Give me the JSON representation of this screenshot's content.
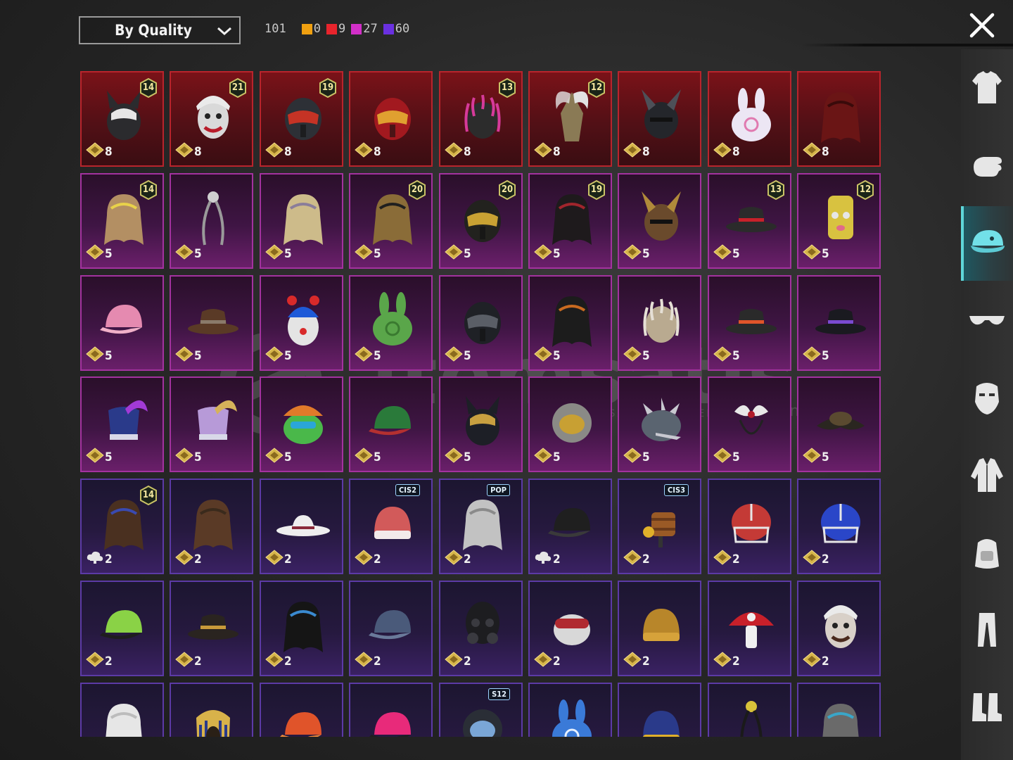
{
  "toolbar": {
    "sort_label": "By Quality",
    "total": "101",
    "counts": [
      {
        "color": "#f0a010",
        "value": "0"
      },
      {
        "color": "#e8242c",
        "value": "9"
      },
      {
        "color": "#d22fc8",
        "value": "27"
      },
      {
        "color": "#6a30e0",
        "value": "60"
      }
    ]
  },
  "watermark": {
    "text": "itemsatis",
    "sub": "HESAP / İTEM / EPİN",
    "com": ".com"
  },
  "sidebar": {
    "items": [
      {
        "name": "outfit",
        "icon": "outfit-icon",
        "active": false
      },
      {
        "name": "emote",
        "icon": "hand-icon",
        "active": false
      },
      {
        "name": "headwear",
        "icon": "cap-icon",
        "active": true
      },
      {
        "name": "eyewear",
        "icon": "glasses-icon",
        "active": false
      },
      {
        "name": "face",
        "icon": "mask-icon",
        "active": false
      },
      {
        "name": "top",
        "icon": "jacket-icon",
        "active": false
      },
      {
        "name": "backpack",
        "icon": "backpack-icon",
        "active": false
      },
      {
        "name": "pants",
        "icon": "pants-icon",
        "active": false
      },
      {
        "name": "shoes",
        "icon": "boots-icon",
        "active": false
      }
    ]
  },
  "items": [
    {
      "q": "red",
      "pts": "8",
      "lvl": "14",
      "shape": "cat-helmet",
      "c1": "#2b2b2e",
      "c2": "#e6e6e6"
    },
    {
      "q": "red",
      "pts": "8",
      "lvl": "21",
      "shape": "joker",
      "c1": "#d9d9d9",
      "c2": "#b81c2a"
    },
    {
      "q": "red",
      "pts": "8",
      "lvl": "19",
      "shape": "visor-helmet",
      "c1": "#2d3036",
      "c2": "#c53325"
    },
    {
      "q": "red",
      "pts": "8",
      "lvl": "",
      "shape": "visor-helmet",
      "c1": "#a2191f",
      "c2": "#e0a030"
    },
    {
      "q": "red",
      "pts": "8",
      "lvl": "13",
      "shape": "dread-mask",
      "c1": "#d63a9a",
      "c2": "#2c2c2c"
    },
    {
      "q": "red",
      "pts": "8",
      "lvl": "12",
      "shape": "winged-helm",
      "c1": "#8a7a55",
      "c2": "#e2e2e2"
    },
    {
      "q": "red",
      "pts": "8",
      "lvl": "",
      "shape": "horn-helm",
      "c1": "#24262b",
      "c2": "#4d5058"
    },
    {
      "q": "red",
      "pts": "8",
      "lvl": "",
      "shape": "bunny",
      "c1": "#ece6f4",
      "c2": "#e07ab0"
    },
    {
      "q": "red",
      "pts": "8",
      "lvl": "",
      "shape": "hair",
      "c1": "#6a1515",
      "c2": "#3a0a0a"
    },
    {
      "q": "pink",
      "pts": "5",
      "lvl": "14",
      "shape": "hair",
      "c1": "#b38f63",
      "c2": "#e8d24a"
    },
    {
      "q": "pink",
      "pts": "5",
      "lvl": "",
      "shape": "antenna",
      "c1": "#9a9a9a",
      "c2": "#d0d0d0"
    },
    {
      "q": "pink",
      "pts": "5",
      "lvl": "",
      "shape": "hair",
      "c1": "#cdbb8a",
      "c2": "#8a7d9a"
    },
    {
      "q": "pink",
      "pts": "5",
      "lvl": "20",
      "shape": "hair",
      "c1": "#8a6c38",
      "c2": "#1f1f1f"
    },
    {
      "q": "pink",
      "pts": "5",
      "lvl": "20",
      "shape": "visor-helmet",
      "c1": "#22221e",
      "c2": "#c9a233"
    },
    {
      "q": "pink",
      "pts": "5",
      "lvl": "19",
      "shape": "hair",
      "c1": "#1e1a1c",
      "c2": "#a0252c"
    },
    {
      "q": "pink",
      "pts": "5",
      "lvl": "",
      "shape": "horn-helm",
      "c1": "#6a4a2c",
      "c2": "#b08a3a"
    },
    {
      "q": "pink",
      "pts": "5",
      "lvl": "13",
      "shape": "hat",
      "c1": "#2b2b2b",
      "c2": "#c8202a"
    },
    {
      "q": "pink",
      "pts": "5",
      "lvl": "12",
      "shape": "can",
      "c1": "#d8c240",
      "c2": "#e6e6e6"
    },
    {
      "q": "pink",
      "pts": "5",
      "lvl": "",
      "shape": "cap",
      "c1": "#e58ab0",
      "c2": "#f0b0c8"
    },
    {
      "q": "pink",
      "pts": "5",
      "lvl": "",
      "shape": "hat",
      "c1": "#5a3a26",
      "c2": "#8a7a6a"
    },
    {
      "q": "pink",
      "pts": "5",
      "lvl": "",
      "shape": "clown",
      "c1": "#e4e4e4",
      "c2": "#1e5ad8"
    },
    {
      "q": "pink",
      "pts": "5",
      "lvl": "",
      "shape": "bunny",
      "c1": "#5aa64a",
      "c2": "#3a7a30"
    },
    {
      "q": "pink",
      "pts": "5",
      "lvl": "",
      "shape": "visor-helmet",
      "c1": "#1f2126",
      "c2": "#5a5e66"
    },
    {
      "q": "pink",
      "pts": "5",
      "lvl": "",
      "shape": "hair",
      "c1": "#1c1c1c",
      "c2": "#c86a20"
    },
    {
      "q": "pink",
      "pts": "5",
      "lvl": "",
      "shape": "dread-mask",
      "c1": "#e6e0d6",
      "c2": "#b9aa90"
    },
    {
      "q": "pink",
      "pts": "5",
      "lvl": "",
      "shape": "hat",
      "c1": "#2a2a2a",
      "c2": "#e0542a"
    },
    {
      "q": "pink",
      "pts": "5",
      "lvl": "",
      "shape": "hat",
      "c1": "#1a1a20",
      "c2": "#7a4ad0"
    },
    {
      "q": "pink",
      "pts": "5",
      "lvl": "",
      "shape": "shako",
      "c1": "#2a3a8a",
      "c2": "#a23ad6"
    },
    {
      "q": "pink",
      "pts": "5",
      "lvl": "",
      "shape": "shako",
      "c1": "#b79ad8",
      "c2": "#d6b25a"
    },
    {
      "q": "pink",
      "pts": "5",
      "lvl": "",
      "shape": "frog",
      "c1": "#4ab84a",
      "c2": "#e07a2a"
    },
    {
      "q": "pink",
      "pts": "5",
      "lvl": "",
      "shape": "cap",
      "c1": "#2a7a3a",
      "c2": "#b43030"
    },
    {
      "q": "pink",
      "pts": "5",
      "lvl": "",
      "shape": "cat-helmet",
      "c1": "#1d1f26",
      "c2": "#c8a040"
    },
    {
      "q": "pink",
      "pts": "5",
      "lvl": "",
      "shape": "astro",
      "c1": "#8a8a86",
      "c2": "#c8a033"
    },
    {
      "q": "pink",
      "pts": "5",
      "lvl": "",
      "shape": "spike-helm",
      "c1": "#5a6470",
      "c2": "#c8c8d0"
    },
    {
      "q": "pink",
      "pts": "5",
      "lvl": "",
      "shape": "bow",
      "c1": "#e8e8e8",
      "c2": "#b01c2a"
    },
    {
      "q": "pink",
      "pts": "5",
      "lvl": "",
      "shape": "tricorn",
      "c1": "#2a2620",
      "c2": "#5a4a30"
    },
    {
      "q": "purple",
      "pts": "2",
      "lvl": "14",
      "shape": "hair",
      "c1": "#4a3020",
      "c2": "#3a4ab0",
      "cloud": true
    },
    {
      "q": "purple",
      "pts": "2",
      "lvl": "",
      "shape": "hair",
      "c1": "#5a3a26",
      "c2": "#3a2a1c"
    },
    {
      "q": "purple",
      "pts": "2",
      "lvl": "",
      "shape": "sunhat",
      "c1": "#eeeeee",
      "c2": "#8a2a3a"
    },
    {
      "q": "purple",
      "pts": "2",
      "lvl": "",
      "tag": "CIS2",
      "shape": "beanie",
      "c1": "#d25a5a",
      "c2": "#f2eaea"
    },
    {
      "q": "purple",
      "pts": "2",
      "lvl": "",
      "tag": "POP",
      "shape": "hair",
      "c1": "#c2c2c2",
      "c2": "#8a8a8a"
    },
    {
      "q": "purple",
      "pts": "2",
      "lvl": "",
      "shape": "cap",
      "c1": "#1f1f1f",
      "c2": "#3a3a3a",
      "cloud": true
    },
    {
      "q": "purple",
      "pts": "2",
      "lvl": "",
      "tag": "CIS3",
      "shape": "barrel",
      "c1": "#9a5a26",
      "c2": "#6a3a1a"
    },
    {
      "q": "purple",
      "pts": "2",
      "lvl": "",
      "shape": "football",
      "c1": "#c43a36",
      "c2": "#e6e6e6"
    },
    {
      "q": "purple",
      "pts": "2",
      "lvl": "",
      "shape": "football",
      "c1": "#2a46c8",
      "c2": "#e6e6e6"
    },
    {
      "q": "purple",
      "pts": "2",
      "lvl": "",
      "shape": "cap",
      "c1": "#8ad246",
      "c2": "#1e1e1e"
    },
    {
      "q": "purple",
      "pts": "2",
      "lvl": "",
      "shape": "hat",
      "c1": "#2a2420",
      "c2": "#c89a3a"
    },
    {
      "q": "purple",
      "pts": "2",
      "lvl": "",
      "shape": "hair",
      "c1": "#151515",
      "c2": "#3a8ad0"
    },
    {
      "q": "purple",
      "pts": "2",
      "lvl": "",
      "shape": "cap",
      "c1": "#4a5a7a",
      "c2": "#6a7a9a"
    },
    {
      "q": "purple",
      "pts": "2",
      "lvl": "",
      "shape": "gasmask",
      "c1": "#1d1d20",
      "c2": "#3a3a40"
    },
    {
      "q": "purple",
      "pts": "2",
      "lvl": "",
      "shape": "goggle",
      "c1": "#d8d8d8",
      "c2": "#b02a30"
    },
    {
      "q": "purple",
      "pts": "2",
      "lvl": "",
      "shape": "beanie",
      "c1": "#b8862a",
      "c2": "#d6a23a"
    },
    {
      "q": "purple",
      "pts": "2",
      "lvl": "",
      "shape": "mushroom",
      "c1": "#c8202a",
      "c2": "#f0f0f0"
    },
    {
      "q": "purple",
      "pts": "2",
      "lvl": "",
      "shape": "joker",
      "c1": "#d8d0c8",
      "c2": "#4a2a1e"
    },
    {
      "q": "purple",
      "pts": "",
      "lvl": "",
      "shape": "hair",
      "c1": "#e6e6e6",
      "c2": "#bcbcbc"
    },
    {
      "q": "purple",
      "pts": "",
      "lvl": "",
      "shape": "pharaoh",
      "c1": "#2a3a8a",
      "c2": "#d8b24a"
    },
    {
      "q": "purple",
      "pts": "",
      "lvl": "",
      "shape": "cap",
      "c1": "#e0542a",
      "c2": "#f08a3a"
    },
    {
      "q": "purple",
      "pts": "",
      "lvl": "",
      "shape": "cap",
      "c1": "#e82a7a",
      "c2": "#1e1e1e"
    },
    {
      "q": "purple",
      "pts": "",
      "lvl": "",
      "tag": "S12",
      "shape": "astro",
      "c1": "#2a2e36",
      "c2": "#7aa6d6"
    },
    {
      "q": "purple",
      "pts": "",
      "lvl": "",
      "shape": "bunny",
      "c1": "#3a7ad8",
      "c2": "#e6f0ff"
    },
    {
      "q": "purple",
      "pts": "",
      "lvl": "",
      "shape": "beanie",
      "c1": "#2a3a8a",
      "c2": "#e0b02a"
    },
    {
      "q": "purple",
      "pts": "",
      "lvl": "",
      "shape": "antenna",
      "c1": "#1a1a1a",
      "c2": "#d8c23a"
    },
    {
      "q": "purple",
      "pts": "",
      "lvl": "",
      "shape": "hair",
      "c1": "#6a6a6a",
      "c2": "#3aa6c8"
    }
  ]
}
